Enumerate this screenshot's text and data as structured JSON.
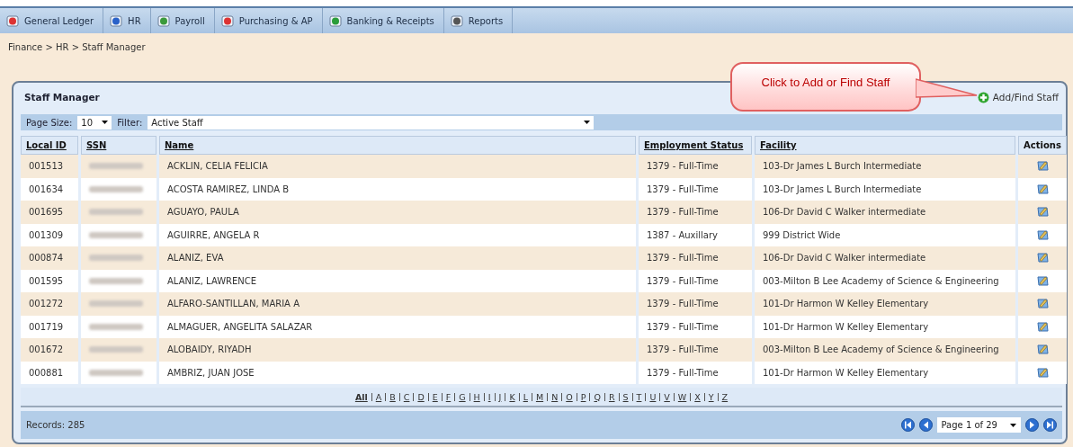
{
  "nav": [
    {
      "label": "General Ledger"
    },
    {
      "label": "HR"
    },
    {
      "label": "Payroll"
    },
    {
      "label": "Purchasing & AP"
    },
    {
      "label": "Banking & Receipts"
    },
    {
      "label": "Reports"
    }
  ],
  "breadcrumb": "Finance > HR > Staff Manager",
  "callout": "Click to Add or Find Staff",
  "panel": {
    "title": "Staff Manager",
    "add_link": "Add/Find Staff",
    "page_size_label": "Page Size:",
    "page_size": "10",
    "filter_label": "Filter:",
    "filter": "Active Staff",
    "columns": [
      "Local ID",
      "SSN",
      "Name",
      "Employment Status",
      "Facility",
      "Actions"
    ],
    "rows": [
      {
        "local_id": "001513",
        "name": "ACKLIN, CELIA FELICIA",
        "status": "1379 - Full-Time",
        "facility": "103-Dr James L Burch Intermediate"
      },
      {
        "local_id": "001634",
        "name": "ACOSTA RAMIREZ, LINDA B",
        "status": "1379 - Full-Time",
        "facility": "103-Dr James L Burch Intermediate"
      },
      {
        "local_id": "001695",
        "name": "AGUAYO, PAULA",
        "status": "1379 - Full-Time",
        "facility": "106-Dr David C Walker intermediate"
      },
      {
        "local_id": "001309",
        "name": "AGUIRRE, ANGELA R",
        "status": "1387 - Auxillary",
        "facility": "999 District Wide"
      },
      {
        "local_id": "000874",
        "name": "ALANIZ, EVA",
        "status": "1379 - Full-Time",
        "facility": "106-Dr David C Walker intermediate"
      },
      {
        "local_id": "001595",
        "name": "ALANIZ, LAWRENCE",
        "status": "1379 - Full-Time",
        "facility": "003-Milton B Lee Academy of Science & Engineering"
      },
      {
        "local_id": "001272",
        "name": "ALFARO-SANTILLAN, MARIA A",
        "status": "1379 - Full-Time",
        "facility": "101-Dr Harmon W Kelley Elementary"
      },
      {
        "local_id": "001719",
        "name": "ALMAGUER, ANGELITA SALAZAR",
        "status": "1379 - Full-Time",
        "facility": "101-Dr Harmon W Kelley Elementary"
      },
      {
        "local_id": "001672",
        "name": "ALOBAIDY, RIYADH",
        "status": "1379 - Full-Time",
        "facility": "003-Milton B Lee Academy of Science & Engineering"
      },
      {
        "local_id": "000881",
        "name": "AMBRIZ, JUAN JOSE",
        "status": "1379 - Full-Time",
        "facility": "101-Dr Harmon W Kelley Elementary"
      }
    ],
    "letters": [
      {
        "label": "All",
        "selected": true
      },
      {
        "label": "A",
        "selected": false
      },
      {
        "label": "B",
        "selected": false
      },
      {
        "label": "C",
        "selected": false
      },
      {
        "label": "D",
        "selected": false
      },
      {
        "label": "E",
        "selected": false
      },
      {
        "label": "F",
        "selected": false
      },
      {
        "label": "G",
        "selected": false
      },
      {
        "label": "H",
        "selected": false
      },
      {
        "label": "I",
        "selected": false
      },
      {
        "label": "J",
        "selected": false
      },
      {
        "label": "K",
        "selected": false
      },
      {
        "label": "L",
        "selected": false
      },
      {
        "label": "M",
        "selected": false
      },
      {
        "label": "N",
        "selected": false
      },
      {
        "label": "O",
        "selected": false
      },
      {
        "label": "P",
        "selected": false
      },
      {
        "label": "Q",
        "selected": false
      },
      {
        "label": "R",
        "selected": false
      },
      {
        "label": "S",
        "selected": false
      },
      {
        "label": "T",
        "selected": false
      },
      {
        "label": "U",
        "selected": false
      },
      {
        "label": "V",
        "selected": false
      },
      {
        "label": "W",
        "selected": false
      },
      {
        "label": "X",
        "selected": false
      },
      {
        "label": "Y",
        "selected": false
      },
      {
        "label": "Z",
        "selected": false
      }
    ],
    "records": "Records: 285",
    "page": "Page 1 of 29"
  }
}
